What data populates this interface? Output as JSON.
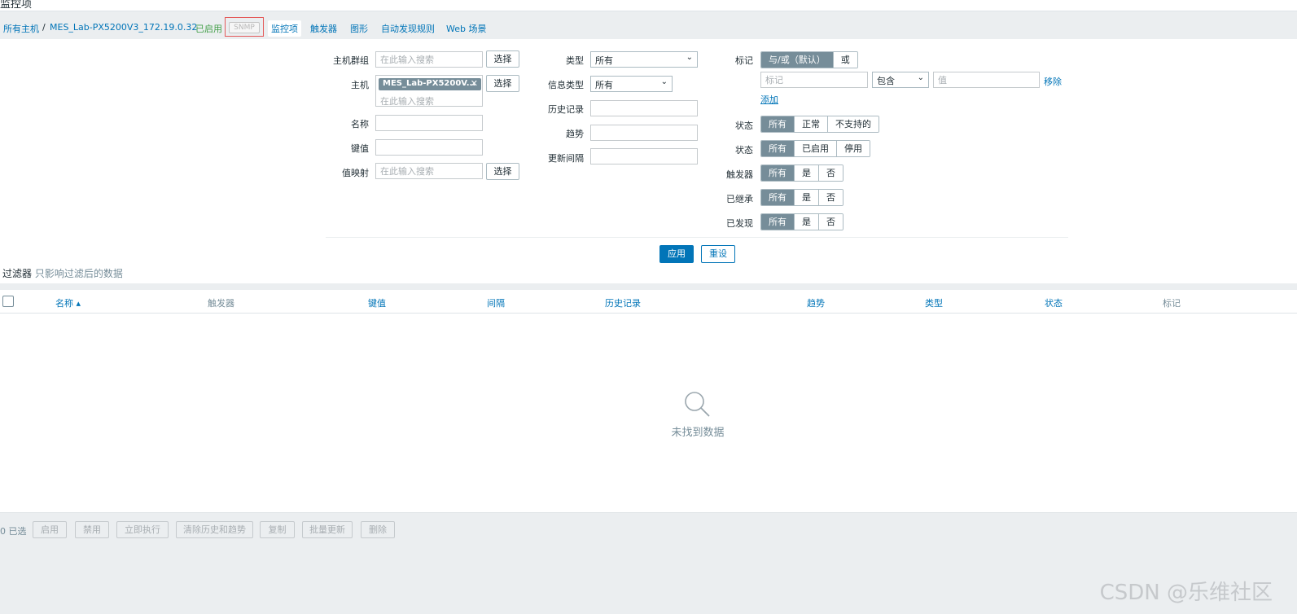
{
  "nav": {
    "all_hosts": "所有主机",
    "separator": "/",
    "host": "MES_Lab-PX5200V3_172.19.0.32",
    "enabled": "已启用",
    "snmp": "SNMP",
    "items": "监控项",
    "triggers": "触发器",
    "graphs": "图形",
    "discovery": "自动发现规则",
    "web": "Web 场景"
  },
  "filter": {
    "host_group_label": "主机群组",
    "search_placeholder": "在此输入搜索",
    "select_label": "选择",
    "host_label": "主机",
    "host_chip": "MES_Lab-PX5200V...",
    "chip_remove": "✕",
    "name_label": "名称",
    "key_label": "键值",
    "valuemap_label": "值映射",
    "type_label": "类型",
    "type_value": "所有",
    "info_type_label": "信息类型",
    "info_type_value": "所有",
    "history_label": "历史记录",
    "trends_label": "趋势",
    "interval_label": "更新间隔",
    "tags_label": "标记",
    "tags_andor": "与/或（默认）",
    "tags_or": "或",
    "tag_placeholder": "标记",
    "tag_operator": "包含",
    "tag_value_placeholder": "值",
    "tag_remove": "移除",
    "tag_add": "添加",
    "state_label": "状态",
    "state_options": [
      "所有",
      "正常",
      "不支持的"
    ],
    "status_label": "状态",
    "status_options": [
      "所有",
      "已启用",
      "停用"
    ],
    "triggers_label": "触发器",
    "inherited_label": "已继承",
    "discovered_label": "已发现",
    "yesno_options": [
      "所有",
      "是",
      "否"
    ],
    "apply": "应用",
    "reset": "重设"
  },
  "filter_title": {
    "title": "过滤器",
    "subtitle": "只影响过滤后的数据"
  },
  "table": {
    "columns": [
      "名称 ▴",
      "触发器",
      "键值",
      "间隔",
      "历史记录",
      "趋势",
      "类型",
      "状态",
      "标记"
    ],
    "empty": "未找到数据"
  },
  "footer": {
    "selected": "0 已选",
    "buttons": [
      "启用",
      "禁用",
      "立即执行",
      "清除历史和趋势",
      "复制",
      "批量更新",
      "删除"
    ]
  },
  "page_title_fragment": "监控项",
  "watermark": "CSDN @乐维社区"
}
